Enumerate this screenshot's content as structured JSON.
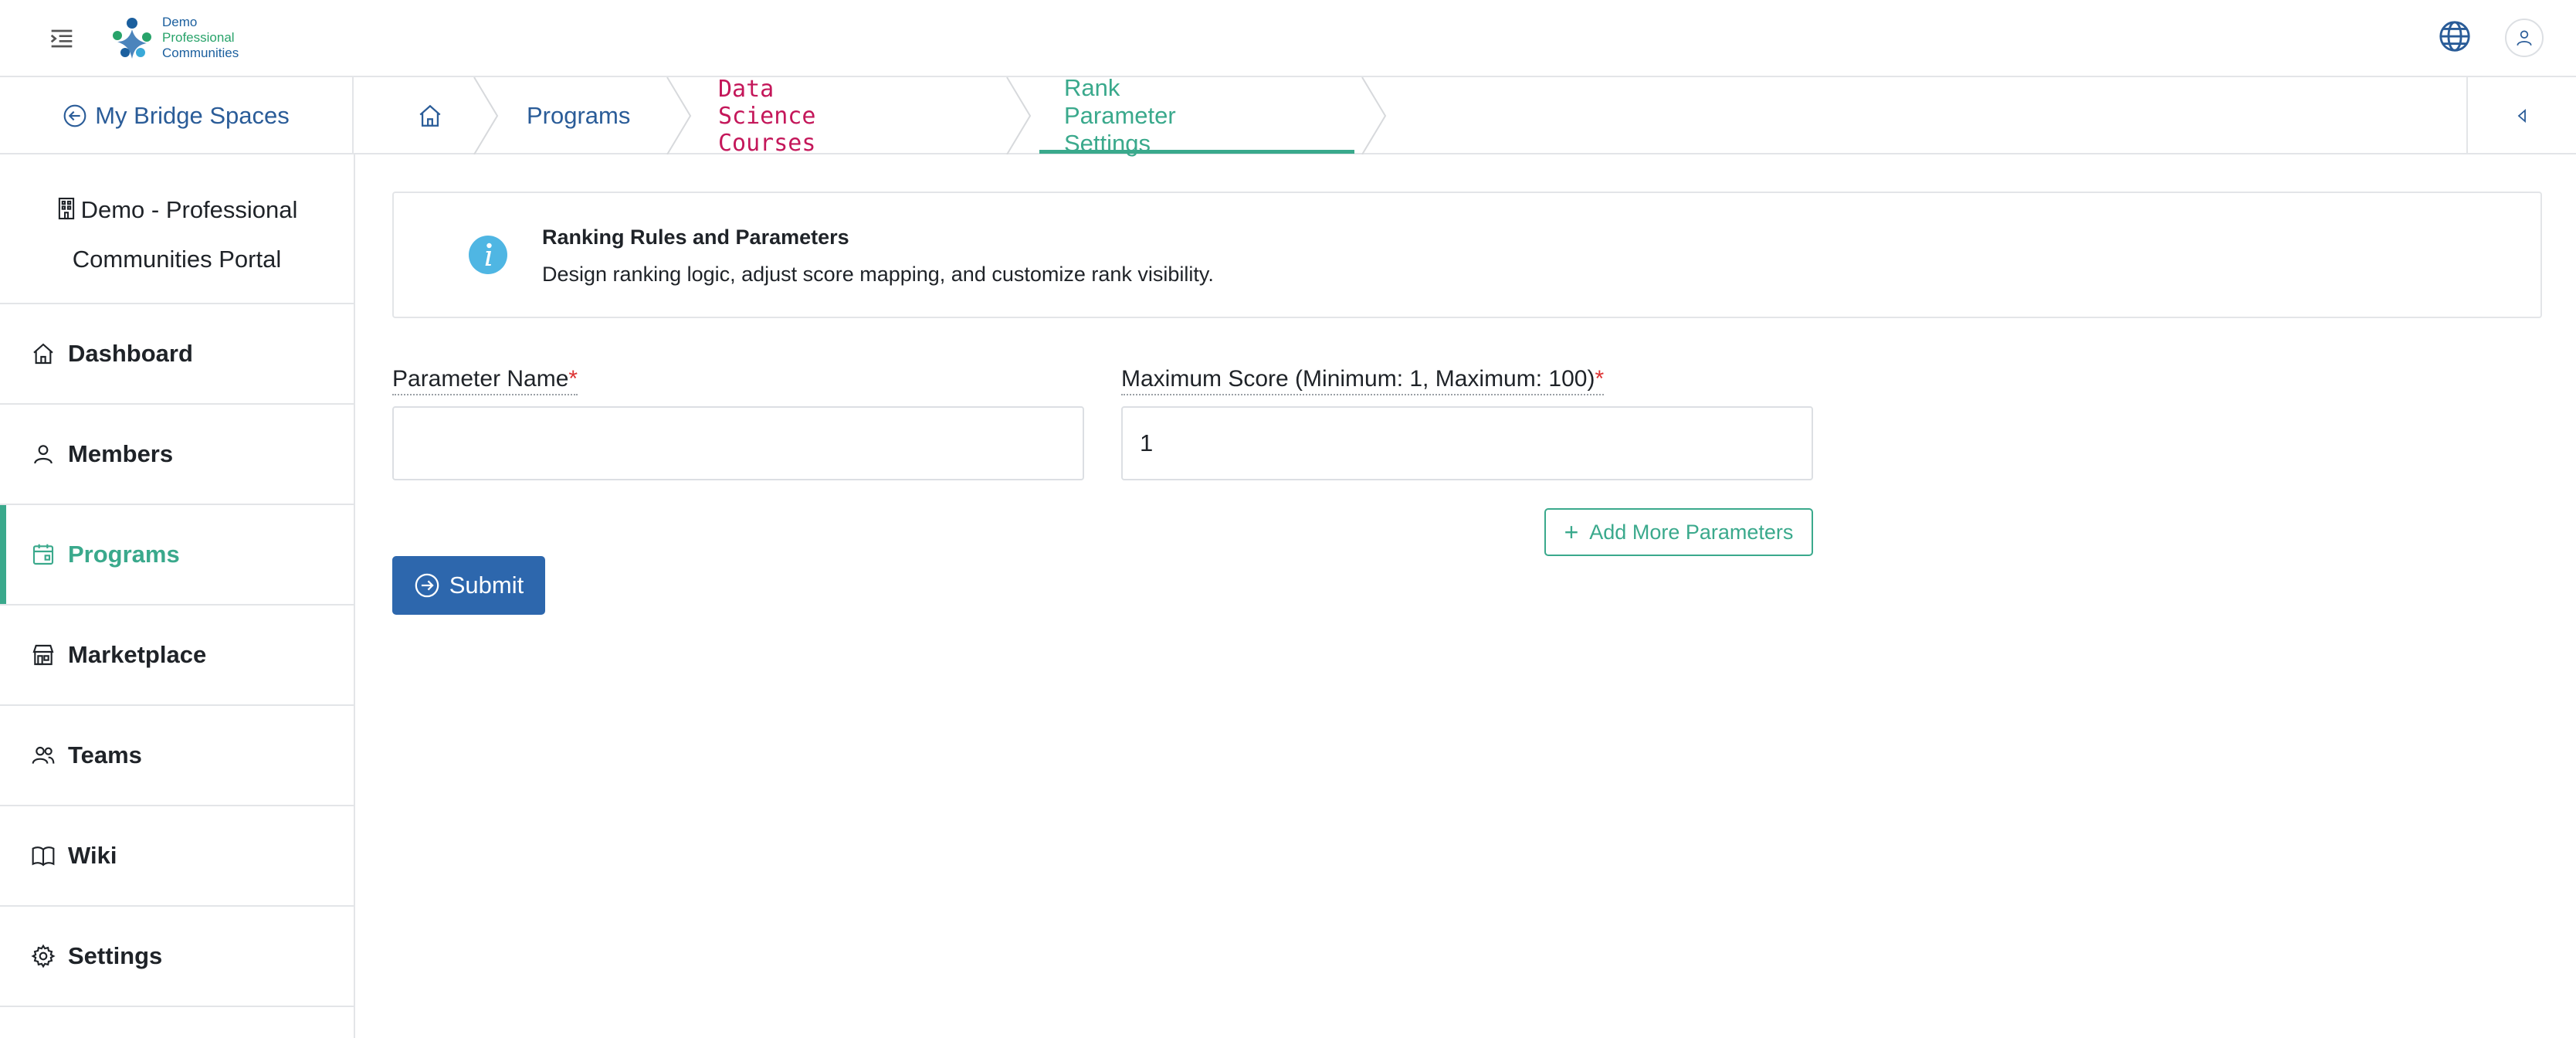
{
  "header": {
    "logo": {
      "line1": "Demo",
      "line2": "Professional",
      "line3": "Communities"
    },
    "icons": {
      "menu": "menu-toggle-icon",
      "globe": "globe-icon",
      "user": "user-icon"
    }
  },
  "breadcrumbs": {
    "back_label": "My Bridge Spaces",
    "items": [
      {
        "label": "Programs"
      },
      {
        "label": "Data Science Courses"
      },
      {
        "label": "Rank Parameter Settings"
      }
    ]
  },
  "sidebar": {
    "portal_name_line1": "Demo - Professional",
    "portal_name_line2": "Communities Portal",
    "items": [
      {
        "label": "Dashboard",
        "icon": "home-icon"
      },
      {
        "label": "Members",
        "icon": "person-icon"
      },
      {
        "label": "Programs",
        "icon": "calendar-icon",
        "active": true
      },
      {
        "label": "Marketplace",
        "icon": "store-icon"
      },
      {
        "label": "Teams",
        "icon": "people-icon"
      },
      {
        "label": "Wiki",
        "icon": "book-icon"
      },
      {
        "label": "Settings",
        "icon": "gear-icon"
      }
    ]
  },
  "info": {
    "title": "Ranking Rules and Parameters",
    "description": "Design ranking logic, adjust score mapping, and customize rank visibility."
  },
  "form": {
    "parameter_name_label": "Parameter Name",
    "parameter_name_value": "",
    "max_score_label": "Maximum Score (Minimum: 1, Maximum: 100)",
    "max_score_value": "1",
    "required_mark": "*",
    "add_more_label": "Add More Parameters",
    "submit_label": "Submit"
  },
  "colors": {
    "accent_green": "#3aa98c",
    "primary_blue": "#2d67ad",
    "link_blue": "#2a5c98",
    "crumb_code": "#c4175a",
    "required": "#dd3333"
  }
}
